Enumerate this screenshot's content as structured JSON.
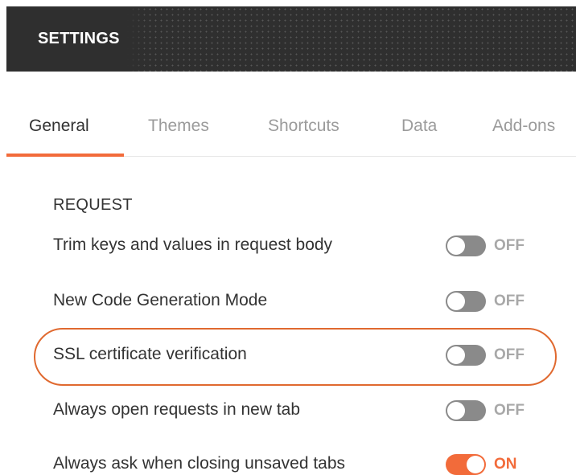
{
  "header": {
    "title": "SETTINGS"
  },
  "tabs": [
    {
      "label": "General",
      "active": true
    },
    {
      "label": "Themes",
      "active": false
    },
    {
      "label": "Shortcuts",
      "active": false
    },
    {
      "label": "Data",
      "active": false
    },
    {
      "label": "Add-ons",
      "active": false
    }
  ],
  "section": {
    "title": "REQUEST"
  },
  "settings": [
    {
      "label": "Trim keys and values in request body",
      "state": "OFF",
      "on": false
    },
    {
      "label": "New Code Generation Mode",
      "state": "OFF",
      "on": false
    },
    {
      "label": "SSL certificate verification",
      "state": "OFF",
      "on": false,
      "highlighted": true
    },
    {
      "label": "Always open requests in new tab",
      "state": "OFF",
      "on": false
    },
    {
      "label": "Always ask when closing unsaved tabs",
      "state": "ON",
      "on": true
    }
  ],
  "colors": {
    "accent": "#f26b3a",
    "header_bg": "#2f2f2f",
    "toggle_off": "#8a8a8a",
    "highlight_ring": "#e0692f"
  }
}
